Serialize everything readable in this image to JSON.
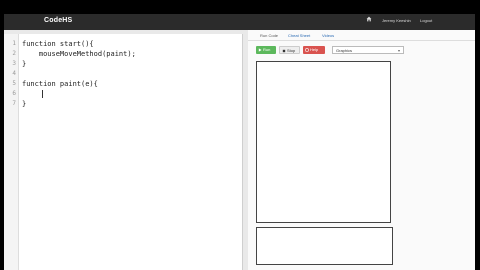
{
  "app": {
    "brand": "CodeHS"
  },
  "header": {
    "user_name": "Jeremy Keeshin",
    "logout_label": "Logout",
    "home_icon": "home-icon"
  },
  "editor": {
    "lines": [
      {
        "n": "1",
        "text": "function start(){"
      },
      {
        "n": "2",
        "text": "    mouseMoveMethod(paint);"
      },
      {
        "n": "3",
        "text": "}"
      },
      {
        "n": "4",
        "text": ""
      },
      {
        "n": "5",
        "text": "function paint(e){"
      },
      {
        "n": "6",
        "text": ""
      },
      {
        "n": "7",
        "text": "}"
      }
    ]
  },
  "right_panel": {
    "tabs": [
      "Run Code",
      "Cheat Sheet",
      "Videos"
    ],
    "buttons": {
      "run": "Run",
      "stop": "Stop",
      "help": "Help"
    },
    "select": {
      "value": "Graphics"
    }
  }
}
